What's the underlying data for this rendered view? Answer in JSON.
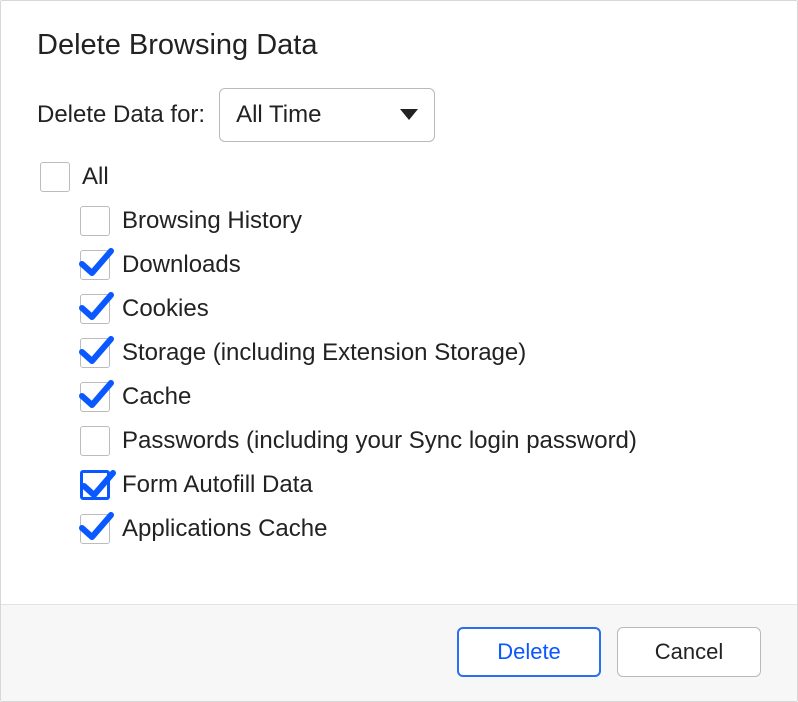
{
  "title": "Delete Browsing Data",
  "time_range": {
    "label": "Delete Data for:",
    "selected": "All Time"
  },
  "master": {
    "label": "All",
    "checked": false,
    "focused": false
  },
  "items": [
    {
      "label": "Browsing History",
      "checked": false,
      "focused": false
    },
    {
      "label": "Downloads",
      "checked": true,
      "focused": false
    },
    {
      "label": "Cookies",
      "checked": true,
      "focused": false
    },
    {
      "label": "Storage (including Extension Storage)",
      "checked": true,
      "focused": false
    },
    {
      "label": "Cache",
      "checked": true,
      "focused": false
    },
    {
      "label": "Passwords (including your Sync login password)",
      "checked": false,
      "focused": false
    },
    {
      "label": "Form Autofill Data",
      "checked": true,
      "focused": true
    },
    {
      "label": "Applications Cache",
      "checked": true,
      "focused": false
    }
  ],
  "buttons": {
    "primary": "Delete",
    "secondary": "Cancel"
  }
}
